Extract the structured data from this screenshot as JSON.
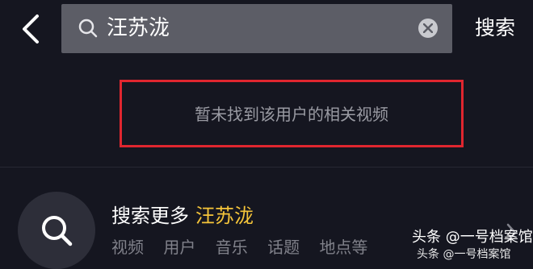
{
  "header": {
    "back_icon": "chevron-left-icon",
    "search_query": "汪苏泷",
    "search_icon": "search-icon",
    "clear_icon": "clear-circle-icon",
    "search_button_label": "搜索"
  },
  "results": {
    "empty_message": "暂未找到该用户的相关视频",
    "highlight_color": "#e0262f"
  },
  "search_more": {
    "prefix": "搜索更多",
    "keyword": "汪苏泷",
    "keyword_color": "#f5c53a",
    "categories": [
      "视频",
      "用户",
      "音乐",
      "话题",
      "地点等"
    ]
  },
  "watermark": {
    "text": "头条 @一号档案馆",
    "partial_text": "头条 @一号档案馆"
  }
}
